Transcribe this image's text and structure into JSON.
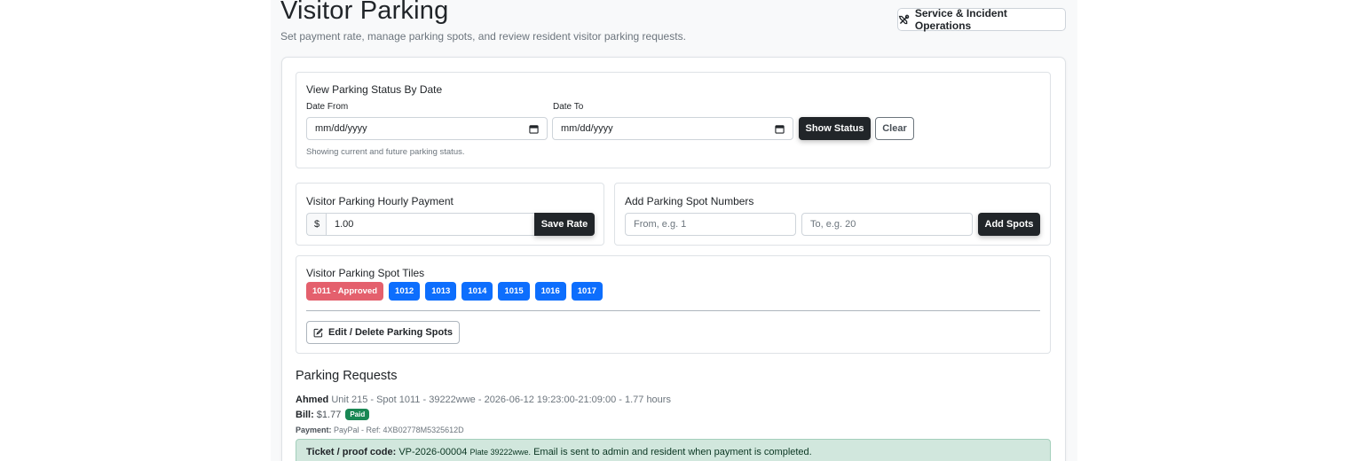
{
  "header": {
    "title": "Visitor Parking",
    "subtitle": "Set payment rate, manage parking spots, and review resident visitor parking requests.",
    "ops_button": "Service & Incident Operations"
  },
  "status_panel": {
    "title": "View Parking Status By Date",
    "date_from_label": "Date From",
    "date_from_value": "mm/dd/yyyy",
    "date_to_label": "Date To",
    "date_to_value": "mm/dd/yyyy",
    "show_button": "Show Status",
    "clear_button": "Clear",
    "hint": "Showing current and future parking status."
  },
  "rate_panel": {
    "title": "Visitor Parking Hourly Payment",
    "currency": "$",
    "rate_value": "1.00",
    "save_button": "Save Rate"
  },
  "spots_panel": {
    "title": "Add Parking Spot Numbers",
    "from_placeholder": "From, e.g. 1",
    "to_placeholder": "To, e.g. 20",
    "add_button": "Add Spots"
  },
  "tiles_panel": {
    "title": "Visitor Parking Spot Tiles",
    "tiles": [
      {
        "label": "1011 - Approved",
        "color": "#e4606d"
      },
      {
        "label": "1012",
        "color": "#0d6efd"
      },
      {
        "label": "1013",
        "color": "#0d6efd"
      },
      {
        "label": "1014",
        "color": "#0d6efd"
      },
      {
        "label": "1015",
        "color": "#0d6efd"
      },
      {
        "label": "1016",
        "color": "#0d6efd"
      },
      {
        "label": "1017",
        "color": "#0d6efd"
      }
    ],
    "edit_button": "Edit / Delete Parking Spots"
  },
  "requests": {
    "title": "Parking Requests",
    "items": [
      {
        "name": "Ahmed",
        "details": "Unit 215 - Spot 1011 - 39222wwe - 2026-06-12 19:23:00-21:09:00 - 1.77 hours",
        "bill_label": "Bill:",
        "bill_value": "$1.77",
        "status": "Paid",
        "payment_label": "Payment:",
        "payment_value": "PayPal - Ref: 4XB02778M5325612D",
        "ticket_label": "Ticket / proof code:",
        "ticket_code": "VP-2026-00004",
        "ticket_plate": "Plate 39222wwe.",
        "ticket_note": "Email is sent to admin and resident when payment is completed."
      }
    ]
  },
  "colors": {
    "dark_button": "#212529",
    "tile_available": "#0d6efd",
    "tile_approved": "#e4606d",
    "paid": "#198754",
    "ticket_bg": "#d1e7dd"
  }
}
